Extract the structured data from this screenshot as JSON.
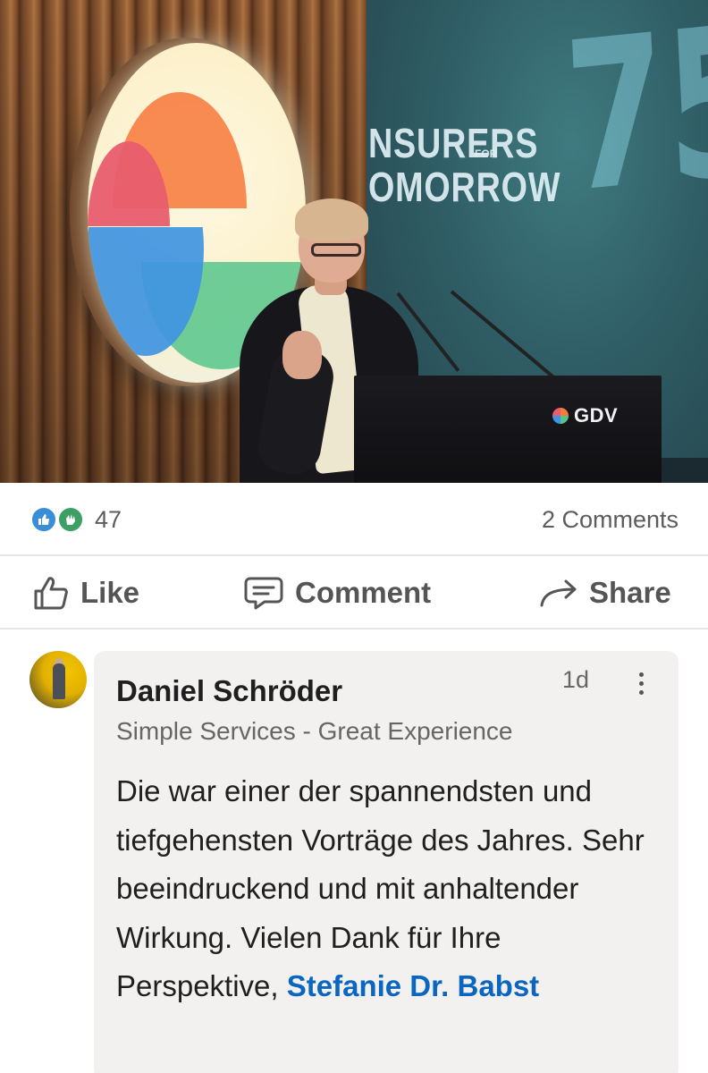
{
  "photo": {
    "screen_line1": "NSURERS",
    "screen_for": "FOR",
    "screen_line2": "OMORROW",
    "screen_number": "75",
    "podium_brand": "GDV"
  },
  "reactions": {
    "icons": [
      "like-icon",
      "clap-icon"
    ],
    "count": "47",
    "comments": "2 Comments"
  },
  "actions": {
    "like": "Like",
    "comment": "Comment",
    "share": "Share"
  },
  "comment": {
    "author": "Daniel Schröder",
    "headline": "Simple Services - Great Experience",
    "time": "1d",
    "text_before_mention": "Die war einer der spannendsten und tiefgehensten Vorträge des Jahres. Sehr beeindruckend und mit anhaltender Wirkung. Vielen Dank für Ihre Perspektive, ",
    "mention": "Stefanie Dr. Babst"
  },
  "colors": {
    "link": "#0b66c2",
    "like_reaction": "#3a8ed8",
    "clap_reaction": "#3e9f64",
    "bubble_bg": "#f2f1ef"
  }
}
